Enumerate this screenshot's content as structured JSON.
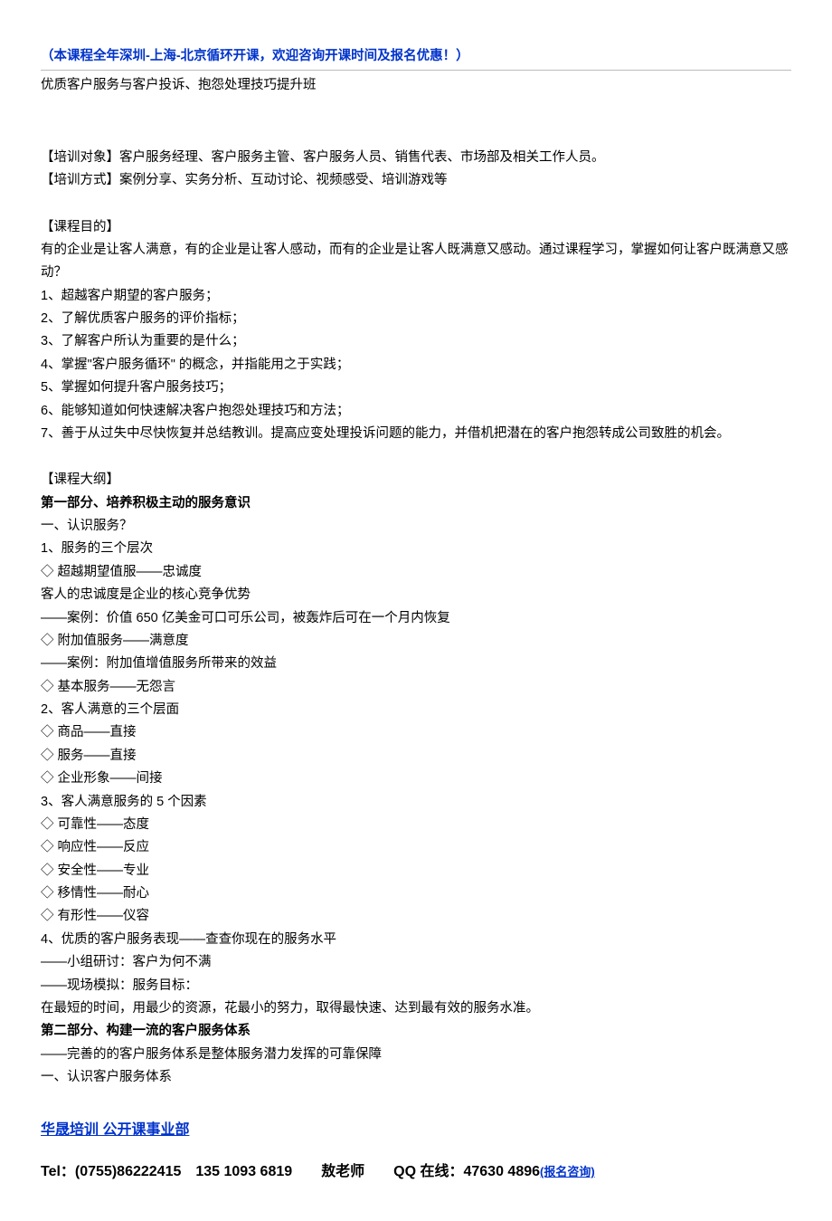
{
  "header": {
    "note": "（本课程全年深圳-上海-北京循环开课，欢迎咨询开课时间及报名优惠！）",
    "subtitle": "优质客户服务与客户投诉、抱怨处理技巧提升班"
  },
  "info": {
    "target": "【培训对象】客户服务经理、客户服务主管、客户服务人员、销售代表、市场部及相关工作人员。",
    "method": "【培训方式】案例分享、实务分析、互动讨论、视频感受、培训游戏等"
  },
  "objective": {
    "label": "【课程目的】",
    "intro": "有的企业是让客人满意，有的企业是让客人感动，而有的企业是让客人既满意又感动。通过课程学习，掌握如何让客户既满意又感动？",
    "items": [
      "1、超越客户期望的客户服务；",
      "2、了解优质客户服务的评价指标；",
      "3、了解客户所认为重要的是什么；",
      "4、掌握\"客户服务循环\" 的概念，并指能用之于实践；",
      "5、掌握如何提升客户服务技巧；",
      "6、能够知道如何快速解决客户抱怨处理技巧和方法；",
      "7、善于从过失中尽快恢复并总结教训。提高应变处理投诉问题的能力，并借机把潜在的客户抱怨转成公司致胜的机会。"
    ]
  },
  "outline": {
    "label": "【课程大纲】",
    "part1_title": "第一部分、培养积极主动的服务意识",
    "part1_lines": [
      "一、认识服务？",
      "1、服务的三个层次",
      "◇ 超越期望值服——忠诚度",
      "客人的忠诚度是企业的核心竞争优势",
      "——案例：价值 650 亿美金可口可乐公司，被轰炸后可在一个月内恢复",
      "◇ 附加值服务——满意度",
      "——案例：附加值增值服务所带来的效益",
      "◇ 基本服务——无怨言",
      "2、客人满意的三个层面",
      "◇ 商品——直接",
      "◇ 服务——直接",
      "◇ 企业形象——间接",
      "3、客人满意服务的 5 个因素",
      "◇ 可靠性——态度",
      "◇ 响应性——反应",
      "◇ 安全性——专业",
      "◇ 移情性——耐心",
      "◇ 有形性——仪容",
      "4、优质的客户服务表现——查查你现在的服务水平",
      "——小组研讨：客户为何不满",
      "——现场模拟：服务目标：",
      "在最短的时间，用最少的资源，花最小的努力，取得最快速、达到最有效的服务水准。"
    ],
    "part2_title": "第二部分、构建一流的客户服务体系",
    "part2_lines": [
      "——完善的的客户服务体系是整体服务潜力发挥的可靠保障",
      "一、认识客户服务体系"
    ]
  },
  "footer": {
    "org": "华晟培训 公开课事业部",
    "contact_prefix": "Tel：(0755)86222415　135 1093 6819　　敖老师　　QQ 在线：47630 4896",
    "register": "(报名咨询)"
  }
}
